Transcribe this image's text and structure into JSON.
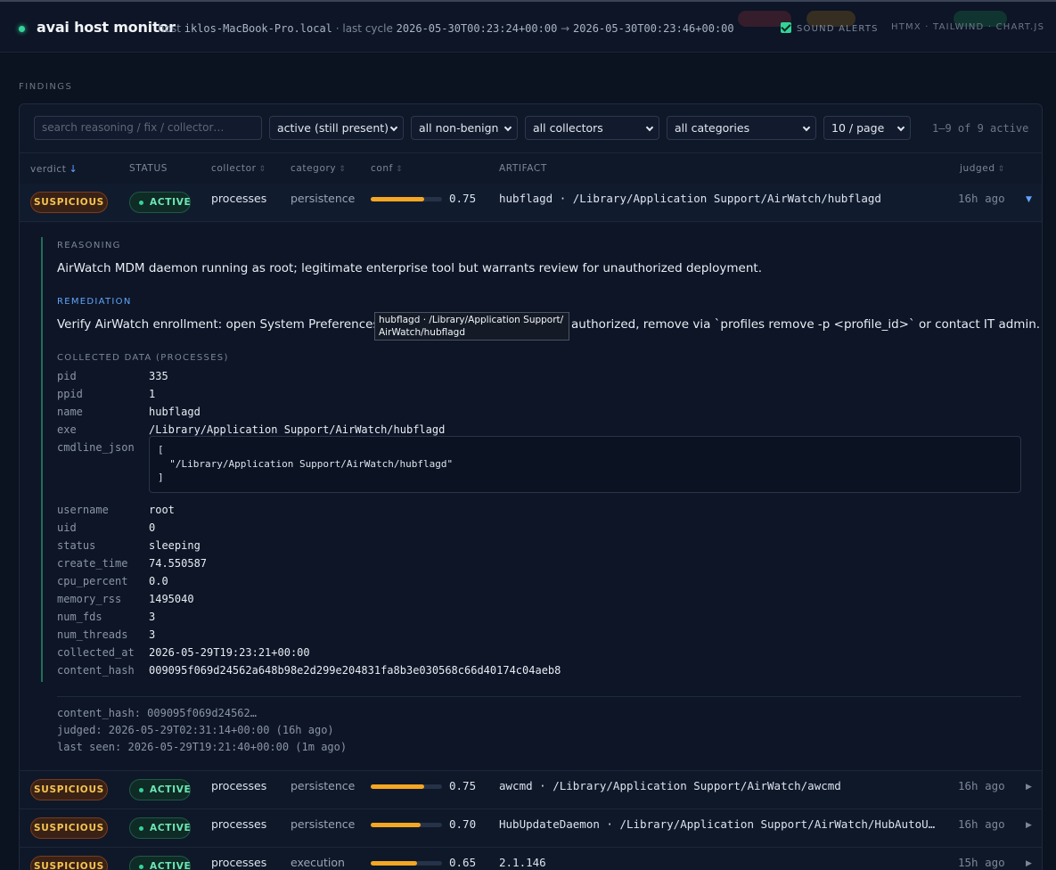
{
  "header": {
    "title": "avai host monitor",
    "host_prefix": "host",
    "host_name": "iklos-MacBook-Pro.local",
    "cycle_prefix": "· last cycle",
    "cycle_start": "2026-05-30T00:23:24+00:00",
    "cycle_arrow": "→",
    "cycle_end": "2026-05-30T00:23:46+00:00",
    "sound_alerts_label": "SOUND ALERTS",
    "sound_alerts_checked": true,
    "tech_stack": "HTMX · TAILWIND · CHART.JS",
    "status_color": "#34d399"
  },
  "findings": {
    "section_label": "FINDINGS",
    "filters": {
      "search_placeholder": "search reasoning / fix / collector…",
      "state": "active (still present)",
      "verdict": "all non-benign",
      "collector": "all collectors",
      "category": "all categories",
      "page_size": "10 / page",
      "summary": "1–9 of 9 active"
    },
    "columns": {
      "verdict": "verdict",
      "status": "STATUS",
      "collector": "collector",
      "category": "category",
      "conf": "conf",
      "artifact": "ARTIFACT",
      "judged": "judged"
    },
    "rows": [
      {
        "verdict": "SUSPICIOUS",
        "status": "ACTIVE",
        "collector": "processes",
        "category": "persistence",
        "conf": 0.75,
        "conf_text": "0.75",
        "artifact": "hubflagd · /Library/Application Support/AirWatch/hubflagd",
        "judged": "16h ago"
      },
      {
        "verdict": "SUSPICIOUS",
        "status": "ACTIVE",
        "collector": "processes",
        "category": "persistence",
        "conf": 0.75,
        "conf_text": "0.75",
        "artifact": "awcmd · /Library/Application Support/AirWatch/awcmd",
        "judged": "16h ago"
      },
      {
        "verdict": "SUSPICIOUS",
        "status": "ACTIVE",
        "collector": "processes",
        "category": "persistence",
        "conf": 0.7,
        "conf_text": "0.70",
        "artifact": "HubUpdateDaemon · /Library/Application Support/AirWatch/HubAutoUpd…",
        "judged": "16h ago"
      },
      {
        "verdict": "SUSPICIOUS",
        "status": "ACTIVE",
        "collector": "processes",
        "category": "execution",
        "conf": 0.65,
        "conf_text": "0.65",
        "artifact": "2.1.146",
        "judged": "15h ago"
      }
    ],
    "detail": {
      "reasoning_label": "REASONING",
      "reasoning": "AirWatch MDM daemon running as root; legitimate enterprise tool but warrants review for unauthorized deployment.",
      "remediation_label": "REMEDIATION",
      "remediation_start": "Verify AirWatch enrollment: open System Preferences >",
      "remediation_end": "authorized, remove via `profiles remove -p <profile_id>` or contact IT admin.",
      "tooltip_line1": "hubflagd · /Library/Application Support/",
      "tooltip_line2": "AirWatch/hubflagd",
      "collected_label": "COLLECTED DATA (PROCESSES)",
      "fields": [
        {
          "key": "pid",
          "value": "335"
        },
        {
          "key": "ppid",
          "value": "1"
        },
        {
          "key": "name",
          "value": "hubflagd"
        },
        {
          "key": "exe",
          "value": "/Library/Application Support/AirWatch/hubflagd"
        },
        {
          "key": "cmdline_json",
          "value": "[\n  \"/Library/Application Support/AirWatch/hubflagd\"\n]"
        },
        {
          "key": "username",
          "value": "root"
        },
        {
          "key": "uid",
          "value": "0"
        },
        {
          "key": "status",
          "value": "sleeping"
        },
        {
          "key": "create_time",
          "value": "74.550587"
        },
        {
          "key": "cpu_percent",
          "value": "0.0"
        },
        {
          "key": "memory_rss",
          "value": "1495040"
        },
        {
          "key": "num_fds",
          "value": "3"
        },
        {
          "key": "num_threads",
          "value": "3"
        },
        {
          "key": "collected_at",
          "value": "2026-05-29T19:23:21+00:00"
        },
        {
          "key": "content_hash",
          "value": "009095f069d24562a648b98e2d299e204831fa8b3e030568c66d40174c04aeb8"
        }
      ],
      "meta_hash": "content_hash: 009095f069d24562…",
      "meta_judged": "judged: 2026-05-29T02:31:14+00:00 (16h ago)",
      "meta_last_seen": "last seen: 2026-05-29T19:21:40+00:00 (1m ago)"
    }
  }
}
